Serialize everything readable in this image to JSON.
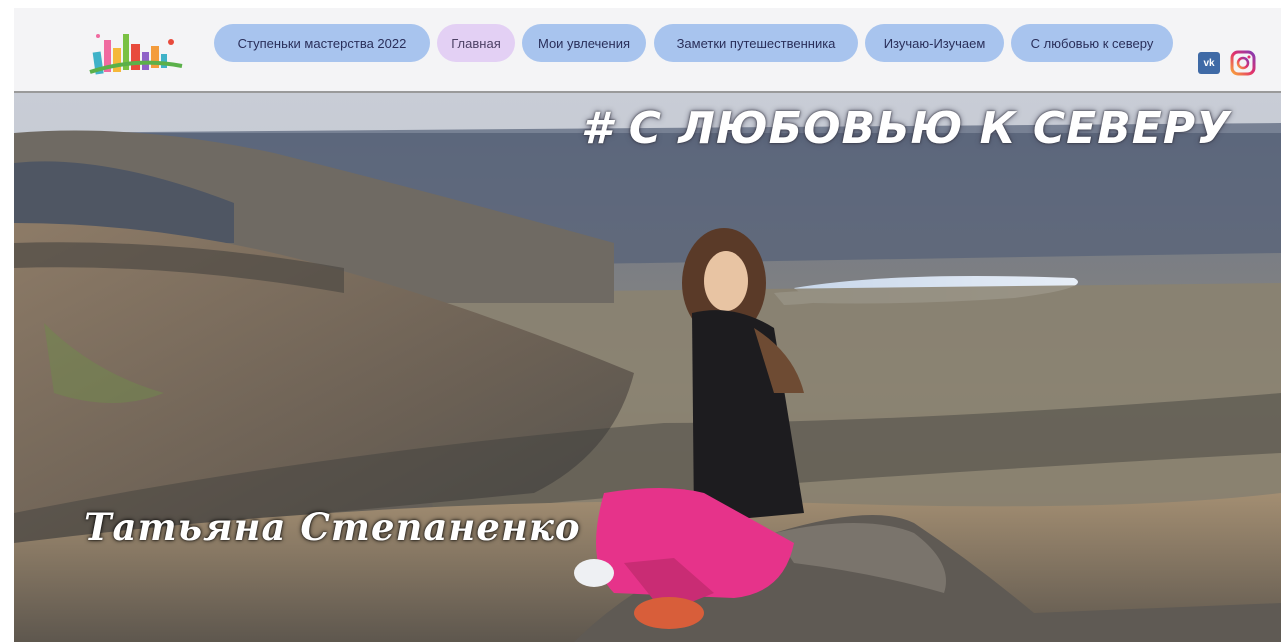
{
  "header": {
    "logo_icon": "colorful-city-logo-icon",
    "nav": [
      {
        "label": "Ступеньки мастерства 2022",
        "active": false
      },
      {
        "label": "Главная",
        "active": true
      },
      {
        "label": "Мои увлечения",
        "active": false
      },
      {
        "label": "Заметки путешественника",
        "active": false
      },
      {
        "label": "Изучаю-Изучаем",
        "active": false
      },
      {
        "label": "С любовью к северу",
        "active": false
      }
    ],
    "social": {
      "vk_label": "vk",
      "vk_icon": "vk-icon",
      "instagram_icon": "instagram-icon"
    }
  },
  "hero": {
    "title": "# С ЛЮБОВЬЮ К СЕВЕРУ",
    "name": "Татьяна Степаненко",
    "image": "photo-woman-sitting-on-mountain-top-icon"
  },
  "colors": {
    "nav_pill": "#a8c4ee",
    "nav_pill_active": "#e3d0f4",
    "nav_text": "#2a2f5a",
    "header_bg": "#f4f4f6"
  }
}
